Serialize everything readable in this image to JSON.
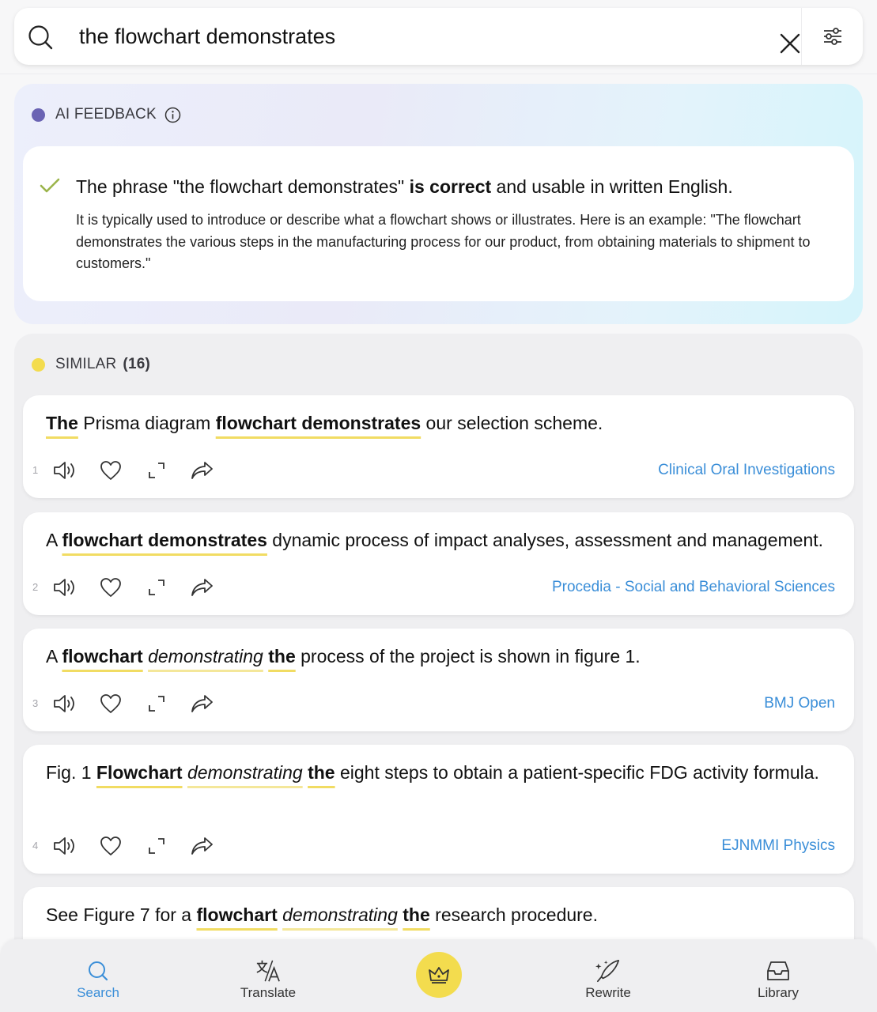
{
  "search": {
    "query": "the flowchart demonstrates"
  },
  "ai_feedback": {
    "heading": "AI FEEDBACK",
    "dot_color": "#6a63b3",
    "verdict_prefix": "The phrase \"the flowchart demonstrates\" ",
    "verdict_bold": "is correct",
    "verdict_suffix": " and usable in written English.",
    "explanation": "It is typically used to introduce or describe what a flowchart shows or illustrates. Here is an example: \"The flowchart demonstrates the various steps in the manufacturing process for our product, from obtaining materials to shipment to customers.\""
  },
  "similar": {
    "heading": "SIMILAR",
    "count": "(16)",
    "dot_color": "#f3dc4e",
    "results": [
      {
        "index": "1",
        "source": "Clinical Oral Investigations",
        "segments": [
          {
            "t": "The",
            "s": "hl"
          },
          {
            "t": " Prisma diagram ",
            "s": ""
          },
          {
            "t": "flowchart demonstrates",
            "s": "hl"
          },
          {
            "t": " our selection scheme.",
            "s": ""
          }
        ]
      },
      {
        "index": "2",
        "source": "Procedia - Social and Behavioral Sciences",
        "segments": [
          {
            "t": "A ",
            "s": ""
          },
          {
            "t": "flowchart demonstrates",
            "s": "hl"
          },
          {
            "t": " dynamic process of impact analyses, assessment and management.",
            "s": ""
          }
        ]
      },
      {
        "index": "3",
        "source": "BMJ Open",
        "segments": [
          {
            "t": "A ",
            "s": ""
          },
          {
            "t": "flowchart",
            "s": "hl"
          },
          {
            "t": " ",
            "s": ""
          },
          {
            "t": "demonstrating",
            "s": "hl-it"
          },
          {
            "t": " ",
            "s": ""
          },
          {
            "t": "the",
            "s": "hl"
          },
          {
            "t": " process of the project is shown in figure 1.",
            "s": ""
          }
        ]
      },
      {
        "index": "4",
        "source": "EJNMMI Physics",
        "segments": [
          {
            "t": "Fig. 1 ",
            "s": ""
          },
          {
            "t": "Flowchart",
            "s": "hl"
          },
          {
            "t": " ",
            "s": ""
          },
          {
            "t": "demonstrating",
            "s": "hl-it"
          },
          {
            "t": " ",
            "s": ""
          },
          {
            "t": "the",
            "s": "hl"
          },
          {
            "t": " eight steps to obtain a patient-specific FDG activity formula.",
            "s": ""
          }
        ]
      },
      {
        "index": "5",
        "source": "",
        "segments": [
          {
            "t": "See Figure 7 for a ",
            "s": ""
          },
          {
            "t": "flowchart",
            "s": "hl"
          },
          {
            "t": " ",
            "s": ""
          },
          {
            "t": "demonstrating",
            "s": "hl-it"
          },
          {
            "t": " ",
            "s": ""
          },
          {
            "t": "the",
            "s": "hl"
          },
          {
            "t": " research procedure.",
            "s": ""
          }
        ]
      }
    ]
  },
  "tabs": [
    {
      "label": "Search",
      "icon": "search-icon",
      "active": true
    },
    {
      "label": "Translate",
      "icon": "translate-icon",
      "active": false
    },
    {
      "label": "",
      "icon": "crown-icon",
      "active": false
    },
    {
      "label": "Rewrite",
      "icon": "quill-icon",
      "active": false
    },
    {
      "label": "Library",
      "icon": "inbox-icon",
      "active": false
    }
  ],
  "colors": {
    "accent_blue": "#3a8ed8",
    "highlight_yellow": "#f1dc63",
    "check_green": "#9bb44a"
  }
}
